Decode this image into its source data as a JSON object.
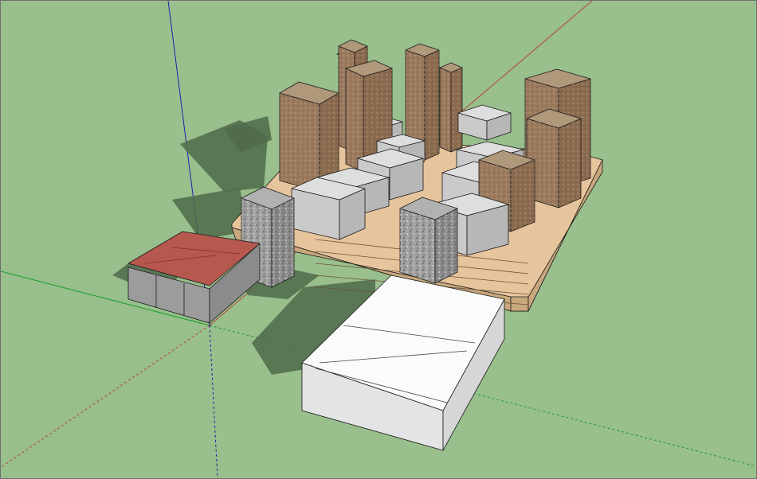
{
  "viewport": {
    "name": "sketchup-3d-model-viewport",
    "colors": {
      "ground": "#98bf8c",
      "shadow": "#4f6a4a",
      "axis_red": "#b3473b",
      "axis_green": "#1a9c2a",
      "axis_blue": "#1f1fb0",
      "brick_top": "#b0987a",
      "brick_left": "#9c7b5e",
      "brick_right": "#8c6c50",
      "grey_top": "#dedede",
      "grey_left": "#cacaca",
      "grey_right": "#b7b7b7",
      "stone_top": "#b1b1b1",
      "stone_left": "#9f9f9f",
      "stone_right": "#8a8a8a",
      "plinth_top": "#e6c49c",
      "plinth_side": "#c8a77c",
      "roof_red": "#b7584f",
      "shed_wall": "#9c9c9c",
      "white_top": "#fbfbfb",
      "white_side": "#e4e4e4",
      "edge": "#1a1a1a"
    }
  }
}
